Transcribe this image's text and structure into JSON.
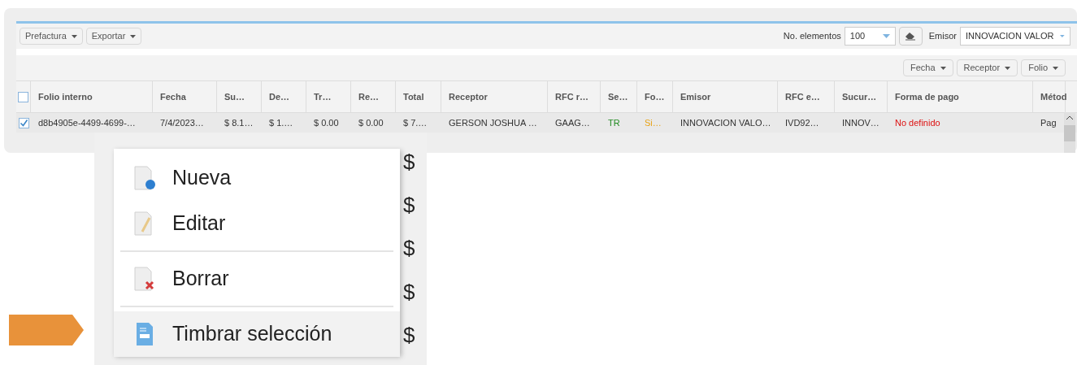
{
  "toolbar": {
    "buttons": [
      "Prefactura",
      "Exportar"
    ],
    "page_size_label": "No. elementos",
    "page_size": "100",
    "issuer_label": "Emisor",
    "issuer": "INNOVACION VALOR"
  },
  "filters": [
    "Fecha",
    "Receptor",
    "Folio"
  ],
  "table": {
    "header_checked": false,
    "columns": [
      "Folio interno",
      "Fecha",
      "Su…",
      "De…",
      "Tr…",
      "Re…",
      "Total",
      "Receptor",
      "RFC r…",
      "Se…",
      "Fo…",
      "Emisor",
      "RFC e…",
      "Sucur…",
      "Forma de pago",
      "Métod"
    ],
    "rows": [
      {
        "checked": true,
        "cells": [
          {
            "text": "d8b4905e-4499-4699-…"
          },
          {
            "text": "7/4/2023…"
          },
          {
            "text": "$ 8.1…"
          },
          {
            "text": "$ 1.…"
          },
          {
            "text": "$ 0.00"
          },
          {
            "text": "$ 0.00"
          },
          {
            "text": "$ 7.…"
          },
          {
            "text": "GERSON JOSHUA …"
          },
          {
            "text": "GAAG…"
          },
          {
            "text": "TR",
            "color": "#228b22"
          },
          {
            "text": "Si…",
            "color": "#e8a317"
          },
          {
            "text": "INNOVACION VALO…"
          },
          {
            "text": "IVD92…"
          },
          {
            "text": "INNOV…"
          },
          {
            "text": "No definido",
            "color": "#dd1111"
          },
          {
            "text": "Pag"
          }
        ]
      }
    ]
  },
  "context_menu": {
    "items": [
      {
        "label": "Nueva",
        "kind": "new",
        "divider_before": false,
        "selected": false
      },
      {
        "label": "Editar",
        "kind": "edit",
        "divider_before": false,
        "selected": false
      },
      {
        "label": "Borrar",
        "kind": "delete",
        "divider_before": true,
        "selected": false
      },
      {
        "label": "Timbrar selección",
        "kind": "stamp",
        "divider_before": true,
        "selected": true
      }
    ],
    "background_marks": [
      "$",
      "$",
      "$",
      "$",
      "$"
    ]
  }
}
